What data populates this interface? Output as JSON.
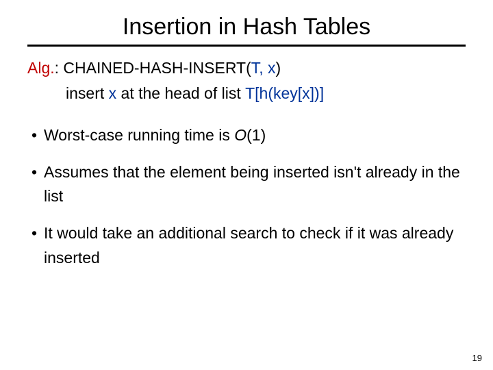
{
  "title": "Insertion in Hash Tables",
  "alg": {
    "label": "Alg.",
    "colon": ": ",
    "name": "CHAINED-HASH-INSERT(",
    "args": "T, x",
    "close": ")"
  },
  "action": {
    "pre": "insert ",
    "x": "x",
    "mid": " at the head of list ",
    "expr": "T[h(key[x])]"
  },
  "bullets": [
    {
      "a": "Worst-case running time is ",
      "b": "O",
      "c": "(1)"
    },
    {
      "a": "Assumes that the element being inserted isn't already in the list"
    },
    {
      "a": "It would take an additional search to check if it was already inserted"
    }
  ],
  "page": "19"
}
